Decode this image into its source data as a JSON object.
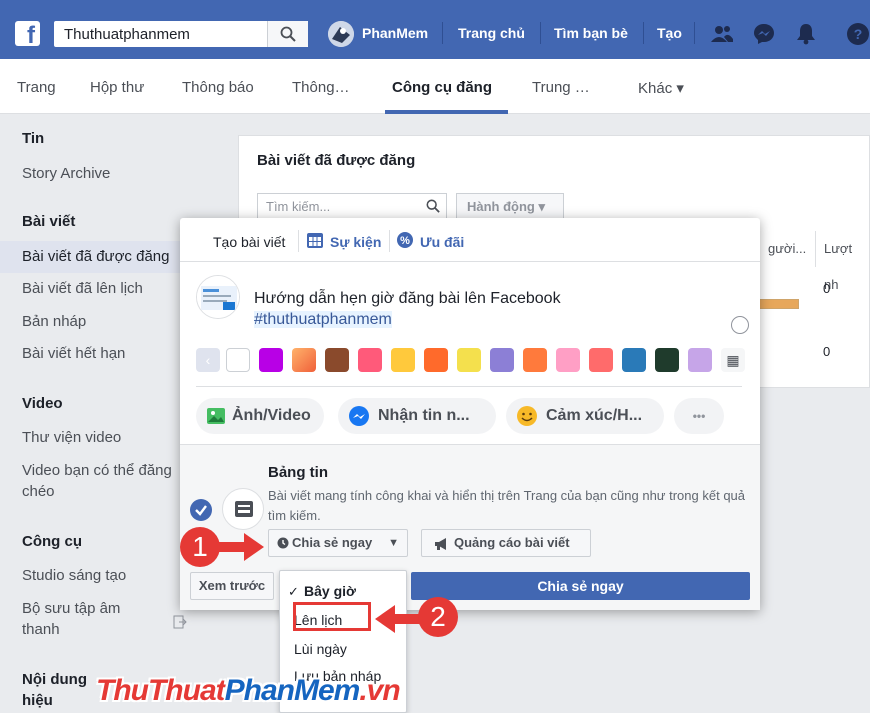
{
  "topbar": {
    "search_value": "Thuthuatphanmem",
    "profile_name": "PhanMem",
    "nav_home": "Trang chủ",
    "nav_friends": "Tìm bạn bè",
    "nav_create": "Tạo"
  },
  "page_tabs": [
    "Trang",
    "Hộp thư",
    "Thông báo",
    "Thông…",
    "Công cụ đăng",
    "Trung …",
    "Khác ▾"
  ],
  "sidebar": {
    "section_tin": "Tin",
    "story_archive": "Story Archive",
    "section_posts": "Bài viết",
    "published": "Bài viết đã được đăng",
    "scheduled": "Bài viết đã lên lịch",
    "drafts": "Bản nháp",
    "expired": "Bài viết hết hạn",
    "section_video": "Video",
    "video_library": "Thư viện video",
    "crosspost_1": "Video bạn có thể đăng",
    "crosspost_2": "chéo",
    "section_tools": "Công cụ",
    "creator_studio": "Studio sáng tạo",
    "sound_1": "Bộ sưu tập âm",
    "sound_2": "thanh",
    "branded_1": "Nội dung",
    "branded_2": "hiệu"
  },
  "published_panel": {
    "title": "Bài viết đã được đăng",
    "search_placeholder": "Tìm kiếm...",
    "action_label": "Hành động ▾",
    "col_reach": "gười...",
    "col_engagement": "Lượt nh",
    "row1_value": "0",
    "row2_value": "0"
  },
  "composer": {
    "tab_create": "Tạo bài viết",
    "tab_event": "Sự kiện",
    "tab_offer": "Ưu đãi",
    "post_text": "Hướng dẫn hẹn giờ đăng bài lên Facebook",
    "post_hashtag": "#thuthuatphanmem",
    "action_photo": "Ảnh/Video",
    "action_message": "Nhận tin n...",
    "action_feeling": "Cảm xúc/H...",
    "action_more": "•••",
    "newsfeed_title": "Bảng tin",
    "newsfeed_desc": "Bài viết mang tính công khai và hiển thị trên Trang của bạn cũng như trong kết quả tìm kiếm.",
    "share_now_dropdown": "Chia sẻ ngay",
    "boost_post": "Quảng cáo bài viết",
    "preview": "Xem trước",
    "share_now_button": "Chia sẻ ngay"
  },
  "share_menu": {
    "now": "Bây giờ",
    "schedule": "Lên lịch",
    "backdate": "Lùi ngày",
    "save_draft": "Lưu bản nháp"
  },
  "annotations": {
    "step1": "1",
    "step2": "2"
  },
  "watermark": {
    "part1": "ThuThuat",
    "part2": "PhanMem",
    "part3": ".vn"
  },
  "colors": {
    "facebook_blue": "#4267b2",
    "annotation_red": "#e53935",
    "background": "#e9ebee"
  }
}
